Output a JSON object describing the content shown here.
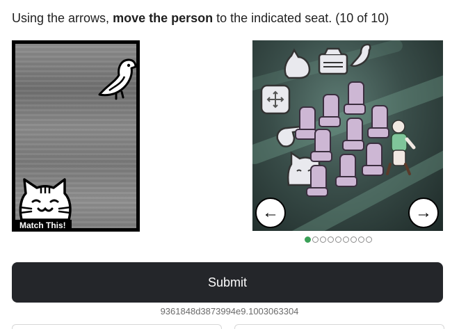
{
  "instruction": {
    "prefix": "Using the arrows, ",
    "bold": "move the person",
    "suffix": " to the indicated seat. (10 of 10)"
  },
  "reference": {
    "label": "Match This!",
    "icons": [
      "bird-icon",
      "cat-icon"
    ]
  },
  "puzzle": {
    "icons": [
      "hand-icon",
      "camera-icon",
      "bird-icon",
      "move-cross-icon",
      "pointing-hand-icon",
      "cat-icon"
    ],
    "left_arrow": "←",
    "right_arrow": "→"
  },
  "pagination": {
    "total": 9,
    "active_index": 0,
    "active_color": "#3aa057"
  },
  "submit_label": "Submit",
  "session_id": "9361848d3873994e9.1003063304",
  "colors": {
    "submit_bg": "#24262a",
    "accent": "#3aa057"
  }
}
